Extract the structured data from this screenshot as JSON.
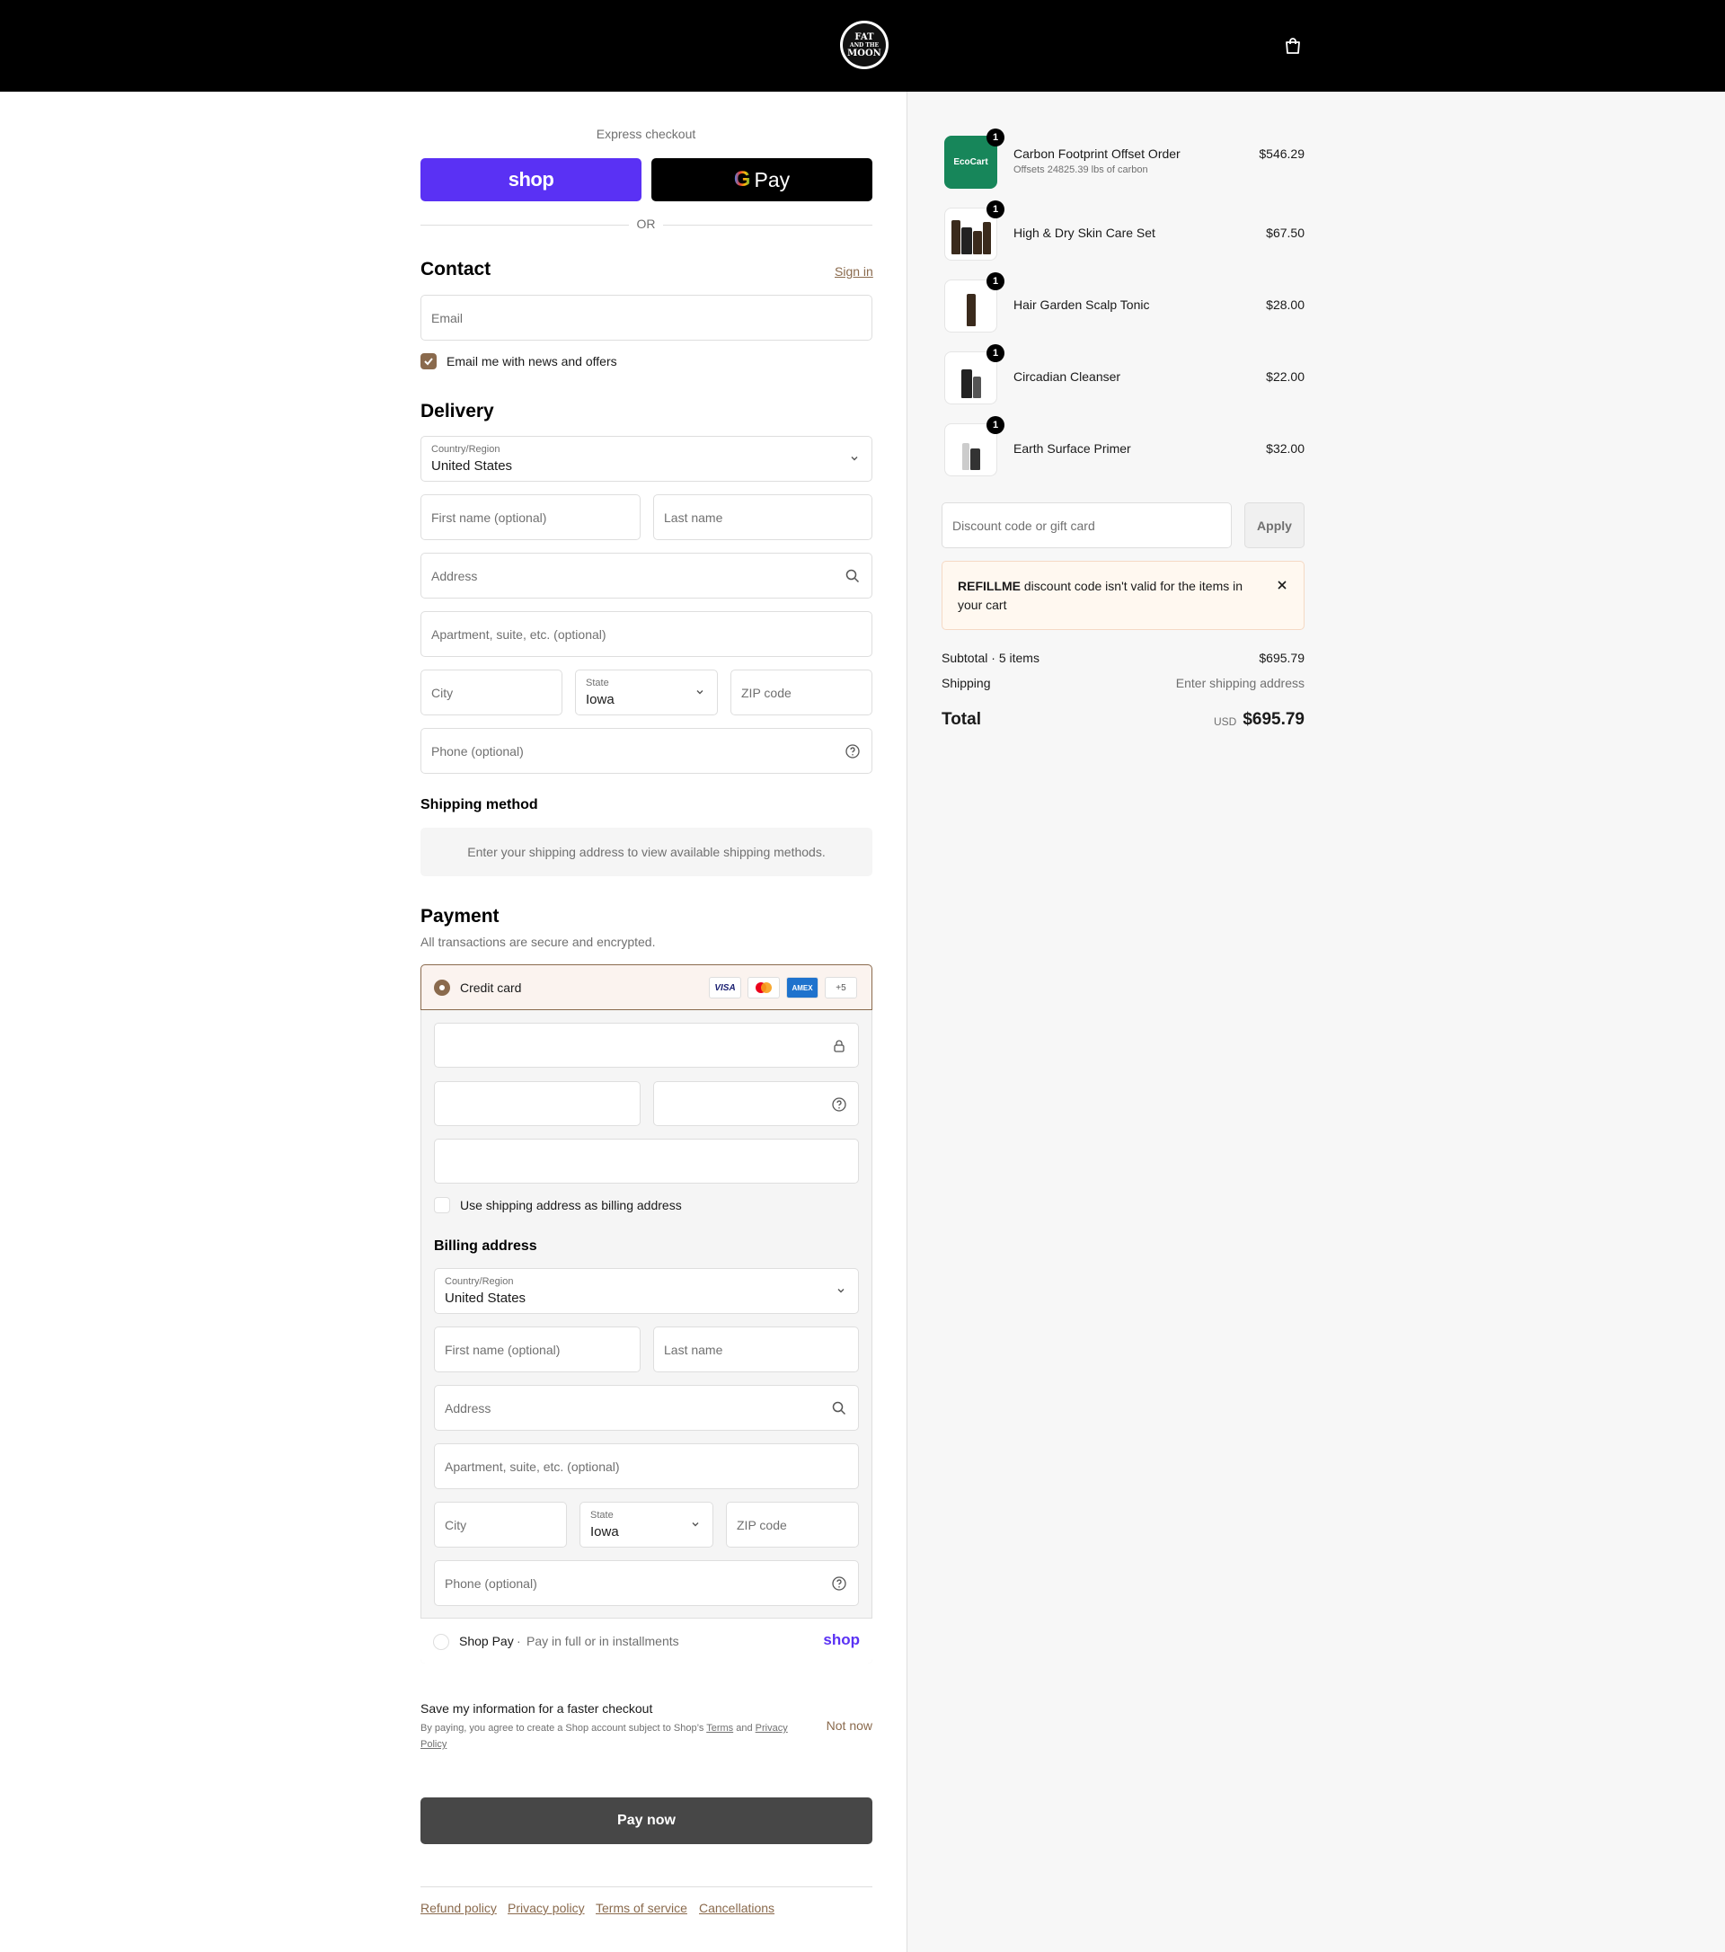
{
  "header": {
    "logo_lines": [
      "FAT",
      "AND THE",
      "MOON"
    ],
    "cart_icon": "shopping-bag-icon"
  },
  "express": {
    "label": "Express checkout",
    "shop_pay_label": "shop",
    "gpay_g": "G",
    "gpay_label": "Pay",
    "or": "OR"
  },
  "contact": {
    "title": "Contact",
    "sign_in": "Sign in",
    "email_placeholder": "Email",
    "newsletter_label": "Email me with news and offers",
    "newsletter_checked": true
  },
  "delivery": {
    "title": "Delivery",
    "country_label": "Country/Region",
    "country_value": "United States",
    "first_name_placeholder": "First name (optional)",
    "last_name_placeholder": "Last name",
    "address_placeholder": "Address",
    "apartment_placeholder": "Apartment, suite, etc. (optional)",
    "city_placeholder": "City",
    "state_label": "State",
    "state_value": "Iowa",
    "zip_placeholder": "ZIP code",
    "phone_placeholder": "Phone (optional)"
  },
  "shipping_method": {
    "title": "Shipping method",
    "message": "Enter your shipping address to view available shipping methods."
  },
  "payment": {
    "title": "Payment",
    "subtitle": "All transactions are secure and encrypted.",
    "credit_card_label": "Credit card",
    "card_brands": [
      "VISA",
      "AMEX",
      "+5"
    ],
    "use_shipping_label": "Use shipping address as billing address",
    "billing_title": "Billing address",
    "billing": {
      "country_label": "Country/Region",
      "country_value": "United States",
      "first_name_placeholder": "First name (optional)",
      "last_name_placeholder": "Last name",
      "address_placeholder": "Address",
      "apartment_placeholder": "Apartment, suite, etc. (optional)",
      "city_placeholder": "City",
      "state_label": "State",
      "state_value": "Iowa",
      "zip_placeholder": "ZIP code",
      "phone_placeholder": "Phone (optional)"
    },
    "shop_pay_label": "Shop Pay",
    "shop_pay_sep": "·",
    "shop_pay_desc": "Pay in full or in installments",
    "shop_pay_logo": "shop"
  },
  "save_info": {
    "title": "Save my information for a faster checkout",
    "text_prefix": "By paying, you agree to create a Shop account subject to Shop’s",
    "terms": "Terms",
    "and": "and",
    "privacy": "Privacy Policy",
    "not_now": "Not now"
  },
  "pay_now": "Pay now",
  "footer_links": [
    "Refund policy",
    "Privacy policy",
    "Terms of service",
    "Cancellations"
  ],
  "order": {
    "items": [
      {
        "name": "Carbon Footprint Offset Order",
        "subtitle": "Offsets 24825.39 lbs of carbon",
        "price": "$546.29",
        "qty": "1",
        "thumb_text": "EcoCart"
      },
      {
        "name": "High & Dry Skin Care Set",
        "price": "$67.50",
        "qty": "1"
      },
      {
        "name": "Hair Garden Scalp Tonic",
        "price": "$28.00",
        "qty": "1"
      },
      {
        "name": "Circadian Cleanser",
        "price": "$22.00",
        "qty": "1"
      },
      {
        "name": "Earth Surface Primer",
        "price": "$32.00",
        "qty": "1"
      }
    ],
    "discount_placeholder": "Discount code or gift card",
    "apply": "Apply",
    "alert_code": "REFILLME",
    "alert_text": "discount code isn't valid for the items in your cart",
    "subtotal_label": "Subtotal · 5 items",
    "subtotal": "$695.79",
    "shipping_label": "Shipping",
    "shipping_value": "Enter shipping address",
    "total_label": "Total",
    "currency": "USD",
    "total": "$695.79"
  },
  "colors": {
    "accent": "#8a6a4d",
    "shop_purple": "#5a31f4",
    "pay_button": "#474747"
  }
}
